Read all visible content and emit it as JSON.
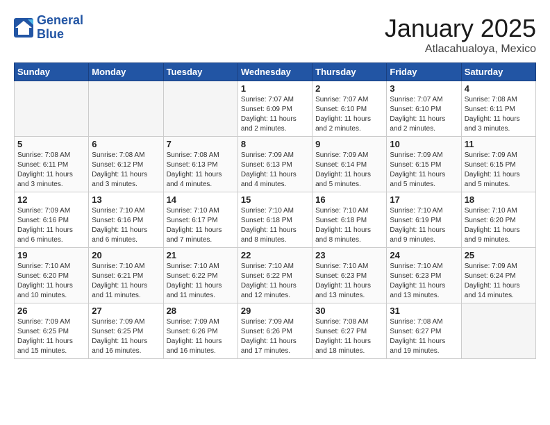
{
  "header": {
    "logo_line1": "General",
    "logo_line2": "Blue",
    "month_title": "January 2025",
    "location": "Atlacahualoya, Mexico"
  },
  "weekdays": [
    "Sunday",
    "Monday",
    "Tuesday",
    "Wednesday",
    "Thursday",
    "Friday",
    "Saturday"
  ],
  "weeks": [
    [
      {
        "day": "",
        "info": ""
      },
      {
        "day": "",
        "info": ""
      },
      {
        "day": "",
        "info": ""
      },
      {
        "day": "1",
        "info": "Sunrise: 7:07 AM\nSunset: 6:09 PM\nDaylight: 11 hours and 2 minutes."
      },
      {
        "day": "2",
        "info": "Sunrise: 7:07 AM\nSunset: 6:10 PM\nDaylight: 11 hours and 2 minutes."
      },
      {
        "day": "3",
        "info": "Sunrise: 7:07 AM\nSunset: 6:10 PM\nDaylight: 11 hours and 2 minutes."
      },
      {
        "day": "4",
        "info": "Sunrise: 7:08 AM\nSunset: 6:11 PM\nDaylight: 11 hours and 3 minutes."
      }
    ],
    [
      {
        "day": "5",
        "info": "Sunrise: 7:08 AM\nSunset: 6:11 PM\nDaylight: 11 hours and 3 minutes."
      },
      {
        "day": "6",
        "info": "Sunrise: 7:08 AM\nSunset: 6:12 PM\nDaylight: 11 hours and 3 minutes."
      },
      {
        "day": "7",
        "info": "Sunrise: 7:08 AM\nSunset: 6:13 PM\nDaylight: 11 hours and 4 minutes."
      },
      {
        "day": "8",
        "info": "Sunrise: 7:09 AM\nSunset: 6:13 PM\nDaylight: 11 hours and 4 minutes."
      },
      {
        "day": "9",
        "info": "Sunrise: 7:09 AM\nSunset: 6:14 PM\nDaylight: 11 hours and 5 minutes."
      },
      {
        "day": "10",
        "info": "Sunrise: 7:09 AM\nSunset: 6:15 PM\nDaylight: 11 hours and 5 minutes."
      },
      {
        "day": "11",
        "info": "Sunrise: 7:09 AM\nSunset: 6:15 PM\nDaylight: 11 hours and 5 minutes."
      }
    ],
    [
      {
        "day": "12",
        "info": "Sunrise: 7:09 AM\nSunset: 6:16 PM\nDaylight: 11 hours and 6 minutes."
      },
      {
        "day": "13",
        "info": "Sunrise: 7:10 AM\nSunset: 6:16 PM\nDaylight: 11 hours and 6 minutes."
      },
      {
        "day": "14",
        "info": "Sunrise: 7:10 AM\nSunset: 6:17 PM\nDaylight: 11 hours and 7 minutes."
      },
      {
        "day": "15",
        "info": "Sunrise: 7:10 AM\nSunset: 6:18 PM\nDaylight: 11 hours and 8 minutes."
      },
      {
        "day": "16",
        "info": "Sunrise: 7:10 AM\nSunset: 6:18 PM\nDaylight: 11 hours and 8 minutes."
      },
      {
        "day": "17",
        "info": "Sunrise: 7:10 AM\nSunset: 6:19 PM\nDaylight: 11 hours and 9 minutes."
      },
      {
        "day": "18",
        "info": "Sunrise: 7:10 AM\nSunset: 6:20 PM\nDaylight: 11 hours and 9 minutes."
      }
    ],
    [
      {
        "day": "19",
        "info": "Sunrise: 7:10 AM\nSunset: 6:20 PM\nDaylight: 11 hours and 10 minutes."
      },
      {
        "day": "20",
        "info": "Sunrise: 7:10 AM\nSunset: 6:21 PM\nDaylight: 11 hours and 11 minutes."
      },
      {
        "day": "21",
        "info": "Sunrise: 7:10 AM\nSunset: 6:22 PM\nDaylight: 11 hours and 11 minutes."
      },
      {
        "day": "22",
        "info": "Sunrise: 7:10 AM\nSunset: 6:22 PM\nDaylight: 11 hours and 12 minutes."
      },
      {
        "day": "23",
        "info": "Sunrise: 7:10 AM\nSunset: 6:23 PM\nDaylight: 11 hours and 13 minutes."
      },
      {
        "day": "24",
        "info": "Sunrise: 7:10 AM\nSunset: 6:23 PM\nDaylight: 11 hours and 13 minutes."
      },
      {
        "day": "25",
        "info": "Sunrise: 7:09 AM\nSunset: 6:24 PM\nDaylight: 11 hours and 14 minutes."
      }
    ],
    [
      {
        "day": "26",
        "info": "Sunrise: 7:09 AM\nSunset: 6:25 PM\nDaylight: 11 hours and 15 minutes."
      },
      {
        "day": "27",
        "info": "Sunrise: 7:09 AM\nSunset: 6:25 PM\nDaylight: 11 hours and 16 minutes."
      },
      {
        "day": "28",
        "info": "Sunrise: 7:09 AM\nSunset: 6:26 PM\nDaylight: 11 hours and 16 minutes."
      },
      {
        "day": "29",
        "info": "Sunrise: 7:09 AM\nSunset: 6:26 PM\nDaylight: 11 hours and 17 minutes."
      },
      {
        "day": "30",
        "info": "Sunrise: 7:08 AM\nSunset: 6:27 PM\nDaylight: 11 hours and 18 minutes."
      },
      {
        "day": "31",
        "info": "Sunrise: 7:08 AM\nSunset: 6:27 PM\nDaylight: 11 hours and 19 minutes."
      },
      {
        "day": "",
        "info": ""
      }
    ]
  ]
}
